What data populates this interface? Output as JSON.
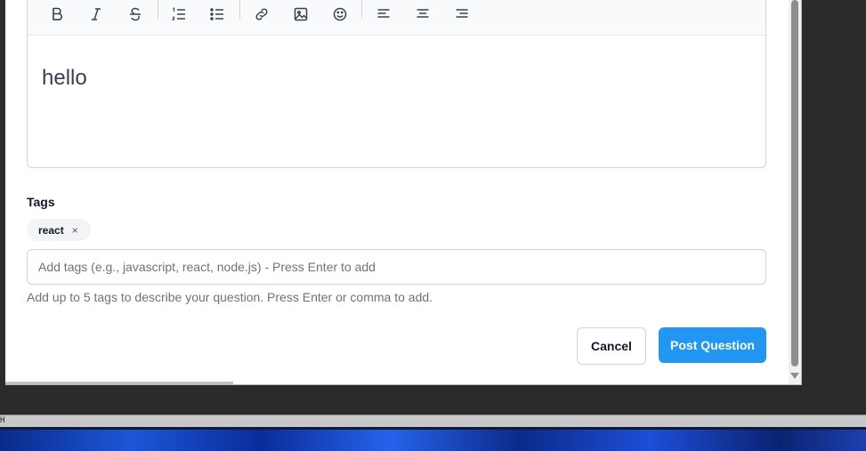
{
  "toolbar": {
    "icons": [
      "bold-icon",
      "italic-icon",
      "strikethrough-icon",
      "ordered-list-icon",
      "unordered-list-icon",
      "link-icon",
      "image-icon",
      "emoji-icon",
      "align-left-icon",
      "align-center-icon",
      "align-right-icon"
    ]
  },
  "editor": {
    "content": "hello"
  },
  "tags": {
    "label": "Tags",
    "chips": [
      {
        "label": "react",
        "remove": "×"
      }
    ],
    "input_placeholder": "Add tags (e.g., javascript, react, node.js) - Press Enter to add",
    "help": "Add up to 5 tags to describe your question. Press Enter or comma to add."
  },
  "actions": {
    "cancel": "Cancel",
    "post": "Post Question"
  },
  "colors": {
    "primary": "#2196f3",
    "border": "#d1d5db",
    "muted": "#6b7280"
  },
  "desktop": {
    "strip_text": "H"
  }
}
